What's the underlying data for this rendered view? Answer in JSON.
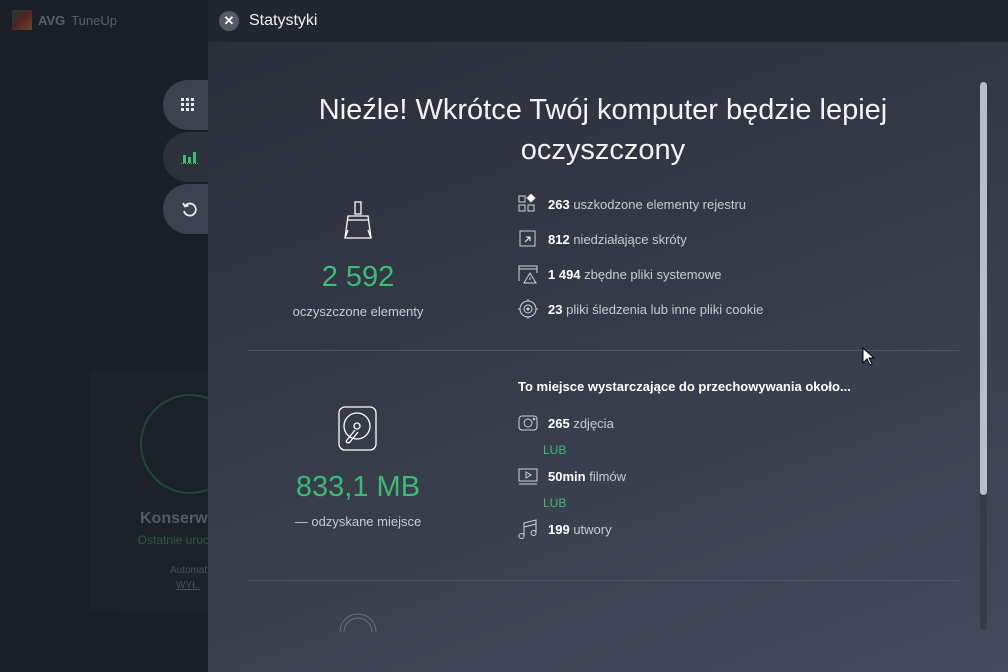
{
  "app": {
    "brand": "AVG",
    "product": "TuneUp"
  },
  "background_card": {
    "title": "Konserwa",
    "status": "Ostatnie urucho minuty te",
    "auto": "Automatyczna kor",
    "toggle": "WYŁ."
  },
  "panel": {
    "title": "Statystyki",
    "headline": "Nieźle! Wkrótce Twój komputer będzie lepiej oczyszczony"
  },
  "cleaned": {
    "value": "2 592",
    "label": "oczyszczone elementy",
    "items": [
      {
        "count": "263",
        "label": "uszkodzone elementy rejestru",
        "icon": "registry-icon"
      },
      {
        "count": "812",
        "label": "niedziałające skróty",
        "icon": "shortcut-icon"
      },
      {
        "count": "1 494",
        "label": "zbędne pliki systemowe",
        "icon": "system-file-warning-icon"
      },
      {
        "count": "23",
        "label": "pliki śledzenia lub inne pliki cookie",
        "icon": "tracking-icon"
      }
    ]
  },
  "space": {
    "value": "833,1 MB",
    "label": "— odzyskane miejsce",
    "header": "To miejsce wystarczające do przechowywania około...",
    "items": [
      {
        "count": "265",
        "label": "zdjęcia",
        "icon": "camera-icon"
      },
      {
        "count": "50min",
        "label": "filmów",
        "icon": "video-icon"
      },
      {
        "count": "199",
        "label": "utwory",
        "icon": "music-icon"
      }
    ],
    "or": "LUB"
  },
  "colors": {
    "accent": "#3dba76"
  }
}
